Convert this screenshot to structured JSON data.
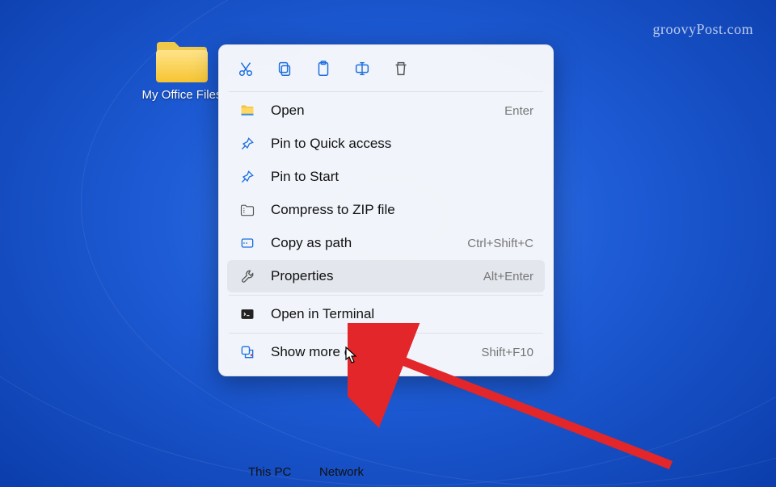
{
  "watermark": "groovyPost.com",
  "folder": {
    "name": "My Office Files"
  },
  "desktop_labels": {
    "this_pc": "This PC",
    "network": "Network"
  },
  "menu": {
    "items": [
      {
        "label": "Open",
        "shortcut": "Enter"
      },
      {
        "label": "Pin to Quick access",
        "shortcut": ""
      },
      {
        "label": "Pin to Start",
        "shortcut": ""
      },
      {
        "label": "Compress to ZIP file",
        "shortcut": ""
      },
      {
        "label": "Copy as path",
        "shortcut": "Ctrl+Shift+C"
      },
      {
        "label": "Properties",
        "shortcut": "Alt+Enter"
      },
      {
        "label": "Open in Terminal",
        "shortcut": ""
      },
      {
        "label": "Show more options",
        "shortcut": "Shift+F10"
      }
    ]
  }
}
